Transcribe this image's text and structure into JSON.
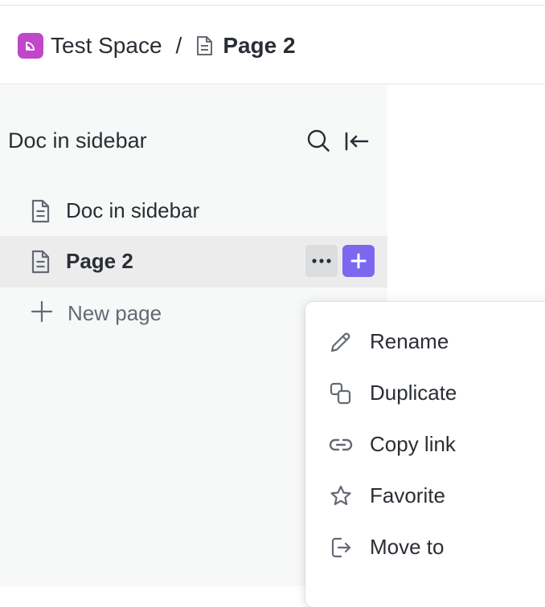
{
  "header": {
    "space_name": "Test Space",
    "separator": "/",
    "current_page": "Page 2",
    "space_avatar_color": "#c047c9",
    "space_icon": "rss-icon"
  },
  "sidebar": {
    "title": "Doc in sidebar",
    "search_icon": "search-icon",
    "collapse_icon": "collapse-sidebar-icon",
    "items": [
      {
        "label": "Doc in sidebar",
        "icon": "document-icon",
        "active": false
      },
      {
        "label": "Page 2",
        "icon": "document-icon",
        "active": true
      }
    ],
    "new_page_label": "New page",
    "accent_color": "#7b68ee"
  },
  "context_menu": {
    "items": [
      {
        "label": "Rename",
        "icon": "pencil-icon"
      },
      {
        "label": "Duplicate",
        "icon": "duplicate-icon"
      },
      {
        "label": "Copy link",
        "icon": "link-icon"
      },
      {
        "label": "Favorite",
        "icon": "star-icon"
      },
      {
        "label": "Move to",
        "icon": "move-to-icon"
      }
    ]
  }
}
